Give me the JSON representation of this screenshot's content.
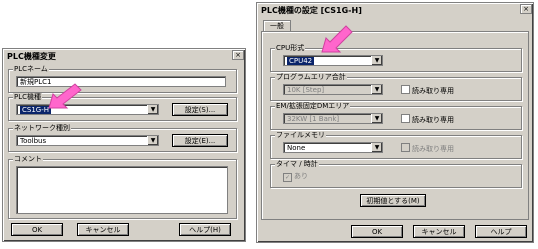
{
  "left_dialog": {
    "title": "PLC機種変更",
    "plc_name_label": "PLCネーム",
    "plc_name_value": "新規PLC1",
    "plc_model_label": "PLC機種",
    "plc_model_value": "CS1G-H",
    "settings_s_label": "設定(S)...",
    "network_label": "ネットワーク種別",
    "network_value": "Toolbus",
    "settings_e_label": "設定(E)...",
    "comment_label": "コメント",
    "ok_label": "OK",
    "cancel_label": "キャンセル",
    "help_label": "ヘルプ(H)"
  },
  "right_dialog": {
    "title": "PLC機種の設定 [CS1G-H]",
    "tab_label": "一般",
    "cpu_label": "CPU形式",
    "cpu_value": "CPU42",
    "program_area_label": "プログラムエリア合計",
    "program_area_value": "10K [Step]",
    "readonly_label_1": "読み取り専用",
    "em_label": "EM/拡張固定DMエリア",
    "em_value": "32KW [1 Bank]",
    "readonly_label_2": "読み取り専用",
    "file_memory_label": "ファイルメモリ",
    "file_memory_value": "None",
    "readonly_label_3": "読み取り専用",
    "timer_label": "タイマ / 時計",
    "timer_checkbox_label": "あり",
    "initialize_label": "初期値とする(M)",
    "ok_label": "OK",
    "cancel_label": "キャンセル",
    "help_label": "ヘルプ"
  },
  "close_glyph": "×",
  "dropdown_glyph": "▼",
  "check_glyph": "✓",
  "arrow_color": "#ff66cc"
}
